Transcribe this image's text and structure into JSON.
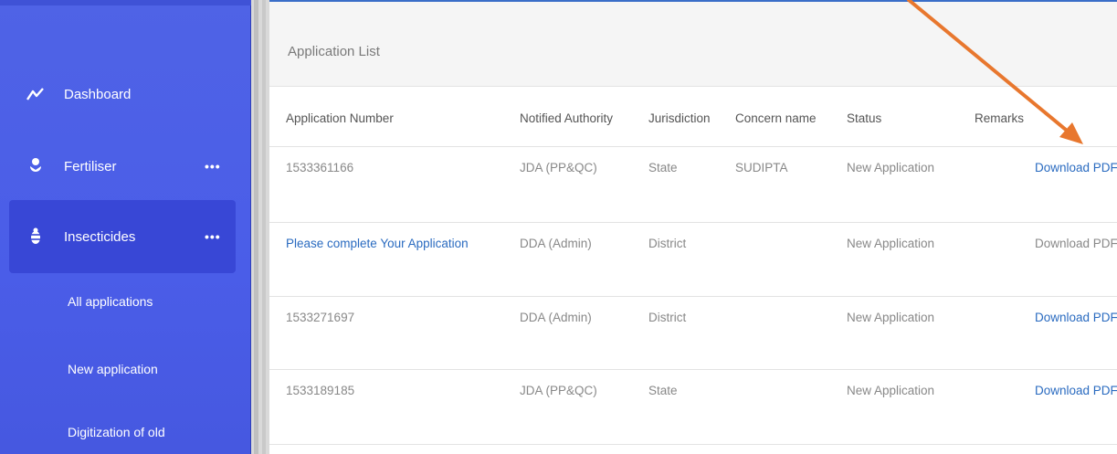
{
  "sidebar": {
    "items": [
      {
        "label": "Dashboard",
        "icon": "chart-line-icon"
      },
      {
        "label": "Fertiliser",
        "icon": "plant-icon",
        "more": "•••"
      },
      {
        "label": "Insecticides",
        "icon": "bug-icon",
        "more": "•••"
      }
    ],
    "subitems": [
      {
        "label": "All applications"
      },
      {
        "label": "New application"
      },
      {
        "label": "Digitization of old"
      }
    ]
  },
  "panel": {
    "title": "Application List",
    "columns": [
      "Application Number",
      "Notified Authority",
      "Jurisdiction",
      "Concern name",
      "Status",
      "Remarks"
    ],
    "rows": [
      {
        "number": "1533361166",
        "authority": "JDA (PP&QC)",
        "jurisdiction": "State",
        "concern": "SUDIPTA",
        "status": "New Application",
        "remarks": "",
        "download": "Download PDF"
      },
      {
        "number": "Please complete Your Application",
        "authority": "DDA (Admin)",
        "jurisdiction": "District",
        "concern": "",
        "status": "New Application",
        "remarks": "",
        "download": "Download PDF"
      },
      {
        "number": "1533271697",
        "authority": "DDA (Admin)",
        "jurisdiction": "District",
        "concern": "",
        "status": "New Application",
        "remarks": "",
        "download": "Download PDF"
      },
      {
        "number": "1533189185",
        "authority": "JDA (PP&QC)",
        "jurisdiction": "State",
        "concern": "",
        "status": "New Application",
        "remarks": "",
        "download": "Download PDF"
      }
    ]
  },
  "colors": {
    "sidebar": "#4a5de8",
    "sidebar_active": "#3847d6",
    "link": "#2a6bc0",
    "annotation_arrow": "#e8772e"
  }
}
